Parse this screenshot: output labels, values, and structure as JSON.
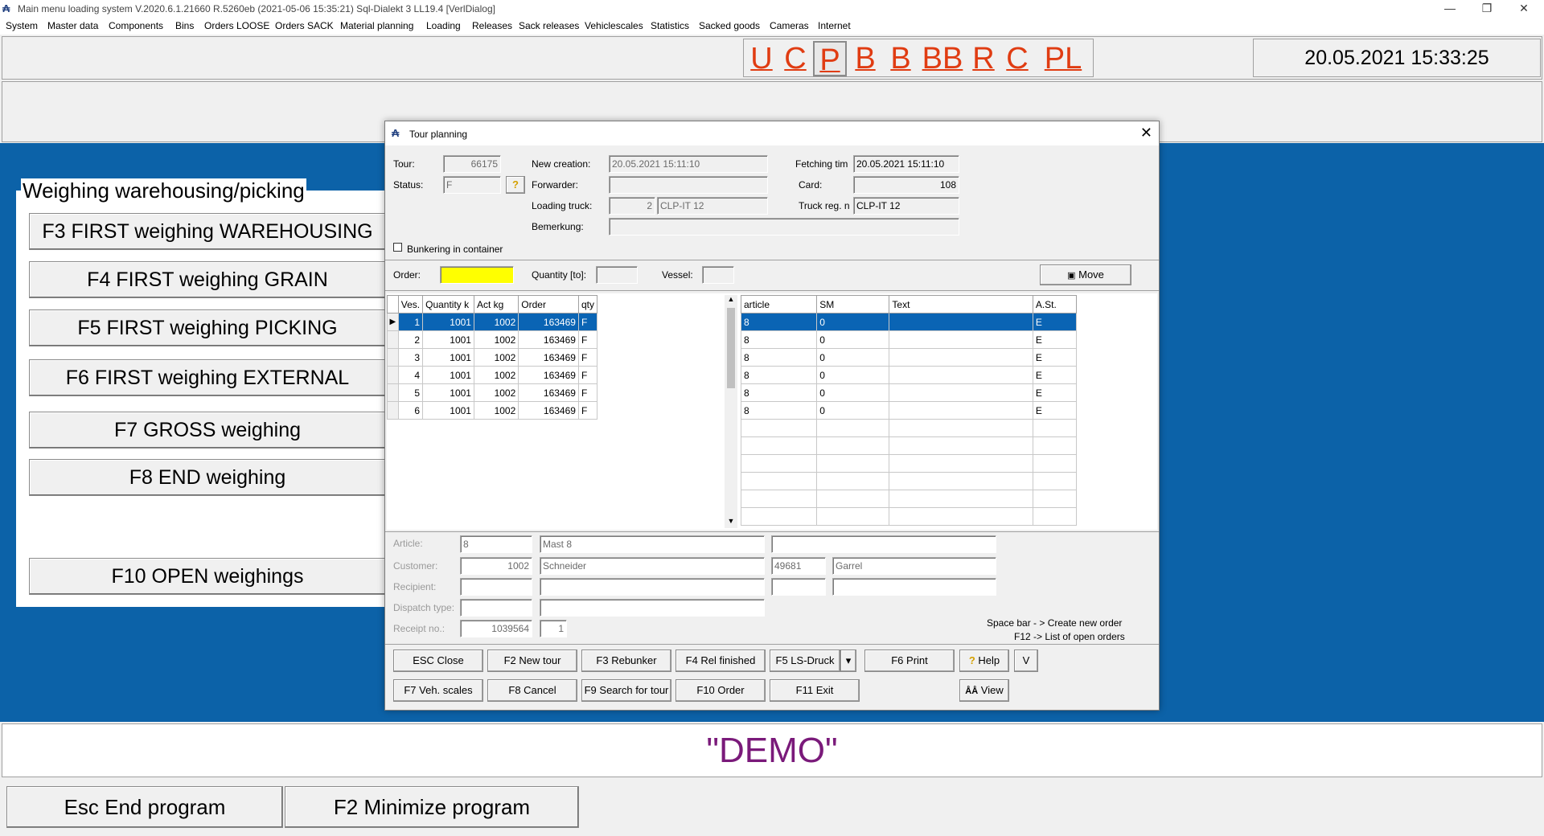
{
  "window": {
    "title": "Main menu loading system V.2020.6.1.21660 R.5260eb (2021-05-06 15:35:21)  Sql-Dialekt 3  LL19.4  [VerlDialog]",
    "icon": "app-logo-icon"
  },
  "menu": [
    "System",
    "Master data",
    "Components",
    "Bins",
    "Orders LOOSE",
    "Orders SACK",
    "Material planning",
    "Loading",
    "Releases",
    "Sack releases",
    "Vehiclescales",
    "Statistics",
    "Sacked goods",
    "Cameras",
    "Internet"
  ],
  "hotkeys": [
    "U",
    "C",
    "P",
    "B",
    "B",
    "BB",
    "R",
    "C",
    "PL"
  ],
  "clock": "20.05.2021 15:33:25",
  "weighing": {
    "group_title": "Weighing warehousing/picking",
    "buttons": [
      "F3 FIRST weighing WAREHOUSING",
      "F4 FIRST weighing GRAIN",
      "F5 FIRST weighing PICKING",
      "F6 FIRST weighing EXTERNAL",
      "F7 GROSS weighing",
      "F8 END weighing",
      "F10 OPEN weighings"
    ]
  },
  "demo": "\"DEMO\"",
  "bottom": {
    "end_program": "Esc End program",
    "minimize_program": "F2 Minimize program"
  },
  "dialog": {
    "title": "Tour planning",
    "labels": {
      "tour": "Tour:",
      "status": "Status:",
      "new_creation": "New creation:",
      "forwarder": "Forwarder:",
      "loading_truck": "Loading truck:",
      "bemerkung": "Bemerkung:",
      "fetching_time": "Fetching tim",
      "card": "Card:",
      "truck_reg": "Truck reg. n",
      "bunkering": "Bunkering in container",
      "order": "Order:",
      "quantity_to": "Quantity [to]:",
      "vessel": "Vessel:"
    },
    "values": {
      "tour": "66175",
      "status": "F",
      "new_creation": "20.05.2021 15:11:10",
      "forwarder": "",
      "loading_truck_no": "2",
      "loading_truck_name": "CLP-IT 12",
      "bemerkung": "",
      "fetching_time": "20.05.2021 15:11:10",
      "card": "108",
      "truck_reg": "CLP-IT 12",
      "order": "",
      "quantity_to": "",
      "vessel": ""
    },
    "move_button": "Move",
    "left_grid": {
      "headers": [
        "Ves.",
        "Quantity k",
        "Act kg",
        "Order",
        "qty"
      ],
      "rows": [
        [
          "1",
          "1001",
          "1002",
          "163469",
          "F"
        ],
        [
          "2",
          "1001",
          "1002",
          "163469",
          "F"
        ],
        [
          "3",
          "1001",
          "1002",
          "163469",
          "F"
        ],
        [
          "4",
          "1001",
          "1002",
          "163469",
          "F"
        ],
        [
          "5",
          "1001",
          "1002",
          "163469",
          "F"
        ],
        [
          "6",
          "1001",
          "1002",
          "163469",
          "F"
        ]
      ]
    },
    "right_grid": {
      "headers": [
        "article",
        "SM",
        "Text",
        "A.St."
      ],
      "rows": [
        [
          "8",
          "0",
          "",
          "E"
        ],
        [
          "8",
          "0",
          "",
          "E"
        ],
        [
          "8",
          "0",
          "",
          "E"
        ],
        [
          "8",
          "0",
          "",
          "E"
        ],
        [
          "8",
          "0",
          "",
          "E"
        ],
        [
          "8",
          "0",
          "",
          "E"
        ]
      ],
      "empty_rows": 6
    },
    "detail": {
      "article_label": "Article:",
      "article_no": "8",
      "article_name": "Mast 8",
      "customer_label": "Customer:",
      "customer_no": "1002",
      "customer_name": "Schneider",
      "customer_zip": "49681",
      "customer_city": "Garrel",
      "recipient_label": "Recipient:",
      "dispatch_label": "Dispatch type:",
      "receipt_label": "Receipt no.:",
      "receipt_no": "1039564",
      "receipt_pos": "1",
      "hint1": "Space bar - > Create new order",
      "hint2": "F12 -> List of open orders"
    },
    "buttons": {
      "esc_close": "ESC Close",
      "new_tour": "F2 New tour",
      "rebunker": "F3 Rebunker",
      "rel_finished": "F4 Rel finished",
      "ls_druck": "F5 LS-Druck",
      "print": "F6 Print",
      "help": "Help",
      "v": "V",
      "veh_scales": "F7 Veh. scales",
      "cancel": "F8 Cancel",
      "search_tour": "F9 Search for tour",
      "order": "F10 Order",
      "exit": "F11 Exit",
      "view": "View"
    }
  }
}
